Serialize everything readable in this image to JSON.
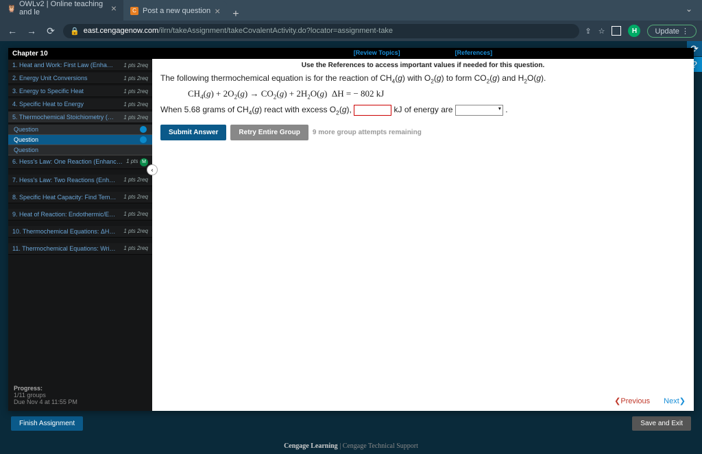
{
  "browser": {
    "tabs": [
      {
        "title": "OWLv2 | Online teaching and le",
        "active": true
      },
      {
        "title": "Post a new question",
        "active": false
      }
    ],
    "url_domain": "east.cengagenow.com",
    "url_path": "/ilrn/takeAssignment/takeCovalentActivity.do?locator=assignment-take",
    "update": "Update",
    "avatar": "H"
  },
  "chapter": "Chapter 10",
  "nav": [
    {
      "label": "1. Heat and Work: First Law (Enha…",
      "pts": "1 pts",
      "req": "2req"
    },
    {
      "label": "2. Energy Unit Conversions",
      "pts": "1 pts",
      "req": "2req"
    },
    {
      "label": "3. Energy to Specific Heat",
      "pts": "1 pts",
      "req": "2req"
    },
    {
      "label": "4. Specific Heat to Energy",
      "pts": "1 pts",
      "req": "2req"
    },
    {
      "label": "5. Thermochemical Stoichiometry (…",
      "pts": "1 pts",
      "req": "2req",
      "active": true,
      "subs": [
        "Question",
        "Question",
        "Question"
      ],
      "sel": 1
    },
    {
      "label": "6. Hess's Law: One Reaction (Enhanc…",
      "pts": "1 pts",
      "req": "",
      "badge": "M"
    },
    {
      "label": "7. Hess's Law: Two Reactions (Enh…",
      "pts": "1 pts",
      "req": "2req"
    },
    {
      "label": "8. Specific Heat Capacity: Find Tem…",
      "pts": "1 pts",
      "req": "2req"
    },
    {
      "label": "9. Heat of Reaction: Endothermic/E…",
      "pts": "1 pts",
      "req": "2req"
    },
    {
      "label": "10. Thermochemical Equations: ΔH…",
      "pts": "1 pts",
      "req": "2req"
    },
    {
      "label": "11. Thermochemical Equations: Wri…",
      "pts": "1 pts",
      "req": "2req"
    }
  ],
  "progress": {
    "label": "Progress:",
    "count": "1/11 groups",
    "due": "Due Nov 4 at 11:55 PM"
  },
  "top_links": {
    "review": "[Review Topics]",
    "refs": "[References]"
  },
  "content": {
    "ref_note": "Use the References to access important values if needed for this question.",
    "intro_a": "The following thermochemical equation is for the reaction of ",
    "intro_b": " with ",
    "intro_c": " to form ",
    "intro_d": " and ",
    "species": {
      "ch4": "CH",
      "o2": "O",
      "co2": "CO",
      "h2o": "H"
    },
    "equation_dh": "ΔH = − 802 kJ",
    "q_a": "When 5.68 grams of ",
    "q_b": " react with excess ",
    "q_c": ", ",
    "q_d": " kJ of energy are ",
    "q_e": "."
  },
  "buttons": {
    "submit": "Submit Answer",
    "retry": "Retry Entire Group",
    "attempts": "9 more group attempts remaining"
  },
  "pager": {
    "prev": "Previous",
    "next": "Next"
  },
  "bottom": {
    "finish": "Finish Assignment",
    "save": "Save and Exit"
  },
  "footer": {
    "brand": "Cengage Learning",
    "sep": " | ",
    "support": "Cengage Technical Support"
  }
}
